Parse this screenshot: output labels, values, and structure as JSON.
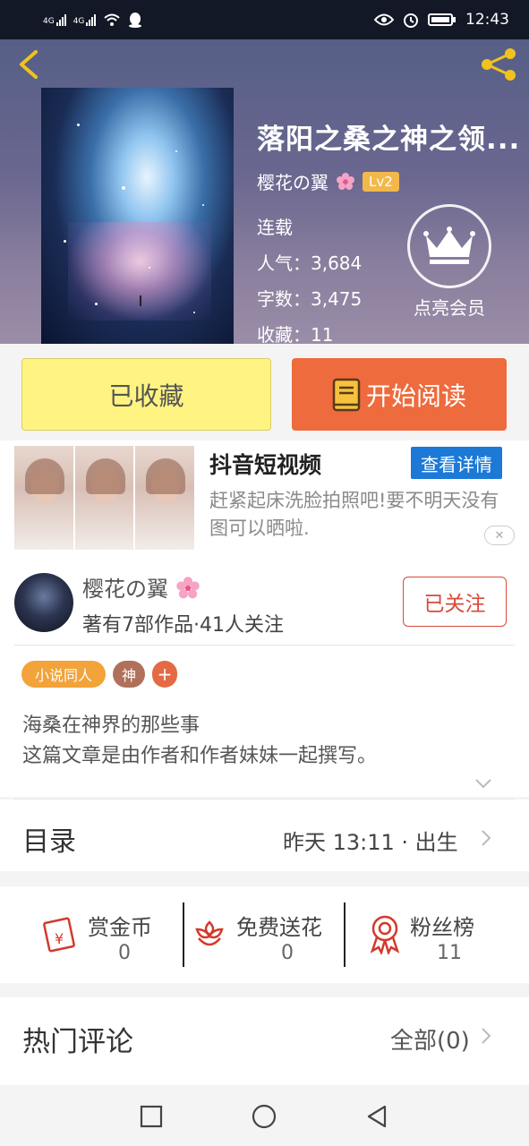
{
  "status_bar": {
    "net1": "4G",
    "net2": "4G",
    "time": "12:43"
  },
  "book": {
    "title": "落阳之桑之神之领...",
    "author": "樱花の翼",
    "author_level": "Lv2",
    "status": "连载",
    "popularity_label": "人气：",
    "popularity": "3,684",
    "word_count_label": "字数：",
    "word_count": "3,475",
    "favorites_label": "收藏：",
    "favorites": "11",
    "vip_label": "点亮会员"
  },
  "actions": {
    "collected_label": "已收藏",
    "read_label": "开始阅读"
  },
  "ad": {
    "title": "抖音短视频",
    "detail_button": "查看详情",
    "description": "赶紧起床洗脸拍照吧!要不明天没有图可以晒啦."
  },
  "author_card": {
    "name": "樱花の翼",
    "stats": "著有7部作品·41人关注",
    "follow_label": "已关注",
    "tags": [
      "小说同人",
      "神",
      "+"
    ],
    "description_lines": [
      "海桑在神界的那些事",
      "这篇文章是由作者和作者妹妹一起撰写。"
    ]
  },
  "toc": {
    "label": "目录",
    "latest": "昨天 13:11 · 出生"
  },
  "rewards": [
    {
      "label": "赏金币",
      "value": "0",
      "icon": "red-envelope-icon"
    },
    {
      "label": "免费送花",
      "value": "0",
      "icon": "flower-icon"
    },
    {
      "label": "粉丝榜",
      "value": "11",
      "icon": "medal-icon"
    }
  ],
  "comments": {
    "title": "热门评论",
    "all_label": "全部(0)"
  },
  "colors": {
    "orange": "#ee6b3e",
    "yellow": "#fff381",
    "red": "#d84a3a",
    "tag_orange": "#f2a33a",
    "tag_brown": "#b0705a",
    "tag_plus": "#e46a45",
    "ad_blue": "#1c79d6"
  }
}
